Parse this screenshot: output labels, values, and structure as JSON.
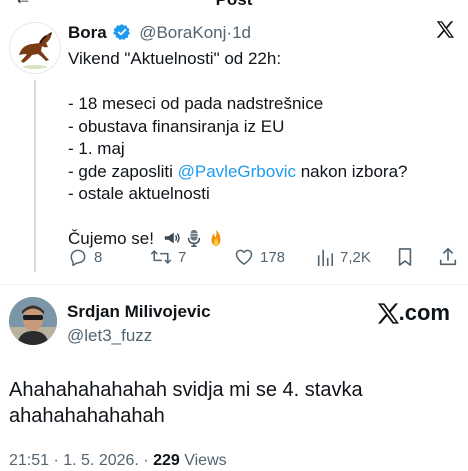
{
  "header": {
    "title": "Post"
  },
  "quoted_post": {
    "author_name": "Bora",
    "author_handle": "@BoraKonj",
    "separator": "·",
    "age": "1d",
    "lines": {
      "l1": "Vikend \"Aktuelnosti\" od 22h:",
      "l2": "- 18 meseci od pada nadstrešnice",
      "l3": "- obustava finansiranja iz EU",
      "l4": "- 1. maj",
      "l5_pre": "- gde zaposliti ",
      "l5_mention": "@PavleGrbovic",
      "l5_post": " nakon izbora?",
      "l6": "- ostale aktuelnosti",
      "l7": "Čujemo se!"
    },
    "emojis": [
      "speaker-emoji",
      "microphone-emoji",
      "fire-emoji"
    ],
    "actions": {
      "replies": "8",
      "reposts": "7",
      "likes": "178",
      "views": "7,2K"
    }
  },
  "post": {
    "author_name": "Srdjan Milivojevic",
    "author_handle": "@let3_fuzz",
    "source_badge": ".com",
    "text_line1": "Ahahahahahahah svidja mi se 4. stavka",
    "text_line2": "ahahahahahahah",
    "timestamp": "21:51 · 1. 5. 2026. · ",
    "views_count": "229",
    "views_label": " Views"
  },
  "colors": {
    "accent": "#1d9bf0",
    "muted": "#536471",
    "text": "#0f1419",
    "divider": "#eff3f4",
    "verified": "#1d9bf0"
  }
}
